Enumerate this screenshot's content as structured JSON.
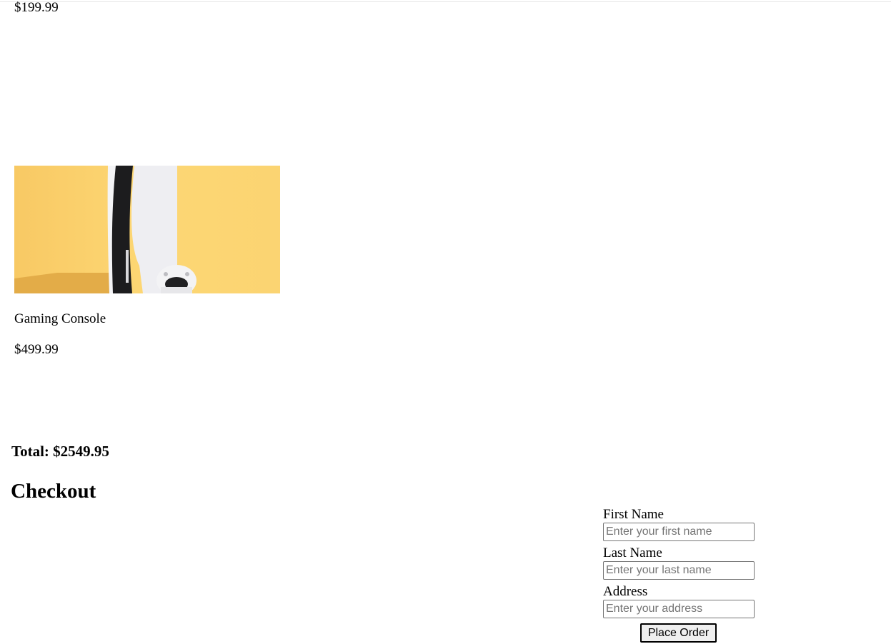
{
  "products": [
    {
      "price": "$199.99"
    },
    {
      "name": "Gaming Console",
      "price": "$499.99",
      "image_alt": "Gaming console on yellow background"
    }
  ],
  "cart": {
    "total": "Total: $2549.95"
  },
  "checkout": {
    "heading": "Checkout",
    "fields": {
      "first_name": {
        "label": "First Name",
        "placeholder": "Enter your first name",
        "value": ""
      },
      "last_name": {
        "label": "Last Name",
        "placeholder": "Enter your last name",
        "value": ""
      },
      "address": {
        "label": "Address",
        "placeholder": "Enter your address",
        "value": ""
      }
    },
    "submit_label": "Place Order"
  },
  "colors": {
    "image_background": "#fbd46e",
    "image_shadow": "#e0ad4a",
    "console_white": "#f1f1f3",
    "console_black": "#1b1b1d"
  }
}
